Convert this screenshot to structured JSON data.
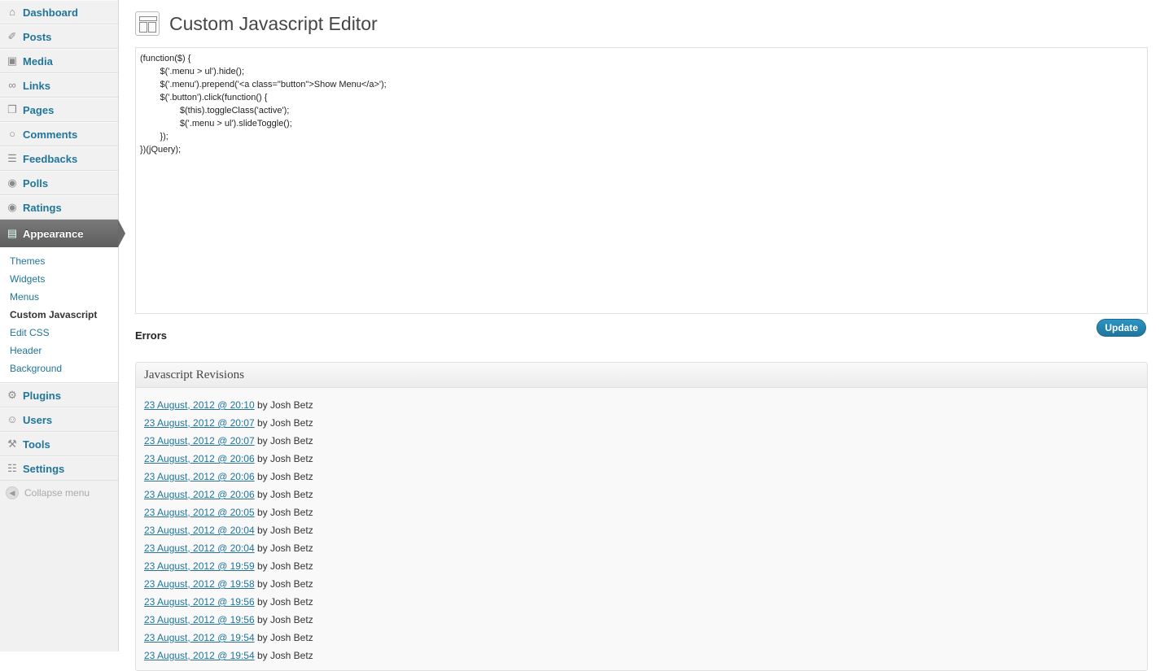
{
  "sidebar": {
    "top_items": [
      {
        "label": "Dashboard",
        "icon": "dashboard-icon"
      },
      {
        "label": "Posts",
        "icon": "pin-icon"
      },
      {
        "label": "Media",
        "icon": "media-icon"
      },
      {
        "label": "Links",
        "icon": "link-icon"
      },
      {
        "label": "Pages",
        "icon": "pages-icon"
      },
      {
        "label": "Comments",
        "icon": "comment-icon"
      },
      {
        "label": "Feedbacks",
        "icon": "feedback-icon"
      },
      {
        "label": "Polls",
        "icon": "poll-icon"
      },
      {
        "label": "Ratings",
        "icon": "rating-icon"
      }
    ],
    "current": {
      "label": "Appearance",
      "icon": "appearance-icon"
    },
    "submenu": [
      "Themes",
      "Widgets",
      "Menus",
      "Custom Javascript",
      "Edit CSS",
      "Header",
      "Background"
    ],
    "submenu_active": "Custom Javascript",
    "bottom_items": [
      {
        "label": "Plugins",
        "icon": "plugin-icon"
      },
      {
        "label": "Users",
        "icon": "users-icon"
      },
      {
        "label": "Tools",
        "icon": "tools-icon"
      },
      {
        "label": "Settings",
        "icon": "settings-icon"
      }
    ],
    "collapse_label": "Collapse menu"
  },
  "page": {
    "title": "Custom Javascript Editor",
    "code": "(function($) {\n        $('.menu > ul').hide();\n        $('.menu').prepend('<a class=\"button\">Show Menu</a>');\n        $('.button').click(function() {\n                $(this).toggleClass('active');\n                $('.menu > ul').slideToggle();\n        });\n})(jQuery);",
    "errors_label": "Errors",
    "update_label": "Update"
  },
  "revisions": {
    "title": "Javascript Revisions",
    "by_prefix": "by",
    "items": [
      {
        "date": "23 August, 2012 @ 20:10",
        "author": "Josh Betz"
      },
      {
        "date": "23 August, 2012 @ 20:07",
        "author": "Josh Betz"
      },
      {
        "date": "23 August, 2012 @ 20:07",
        "author": "Josh Betz"
      },
      {
        "date": "23 August, 2012 @ 20:06",
        "author": "Josh Betz"
      },
      {
        "date": "23 August, 2012 @ 20:06",
        "author": "Josh Betz"
      },
      {
        "date": "23 August, 2012 @ 20:06",
        "author": "Josh Betz"
      },
      {
        "date": "23 August, 2012 @ 20:05",
        "author": "Josh Betz"
      },
      {
        "date": "23 August, 2012 @ 20:04",
        "author": "Josh Betz"
      },
      {
        "date": "23 August, 2012 @ 20:04",
        "author": "Josh Betz"
      },
      {
        "date": "23 August, 2012 @ 19:59",
        "author": "Josh Betz"
      },
      {
        "date": "23 August, 2012 @ 19:58",
        "author": "Josh Betz"
      },
      {
        "date": "23 August, 2012 @ 19:56",
        "author": "Josh Betz"
      },
      {
        "date": "23 August, 2012 @ 19:56",
        "author": "Josh Betz"
      },
      {
        "date": "23 August, 2012 @ 19:54",
        "author": "Josh Betz"
      },
      {
        "date": "23 August, 2012 @ 19:54",
        "author": "Josh Betz"
      }
    ]
  }
}
